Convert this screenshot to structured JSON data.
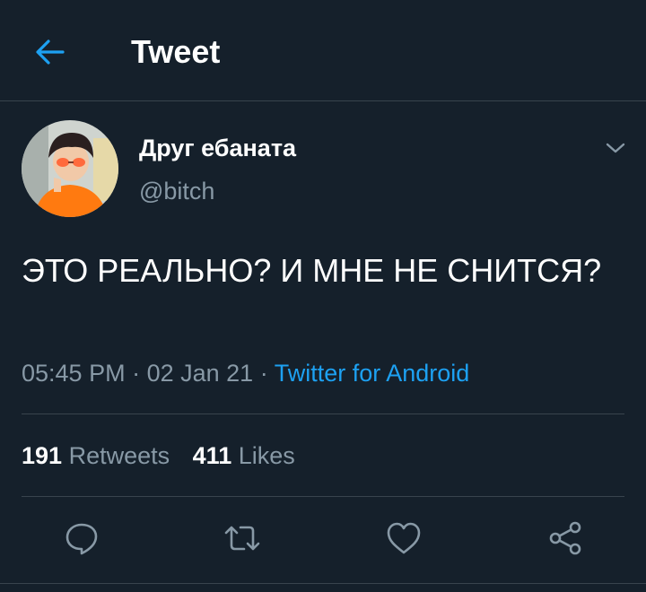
{
  "header": {
    "title": "Tweet",
    "back_icon": "arrow-left-icon"
  },
  "tweet": {
    "author": {
      "display_name": "Друг ебаната",
      "handle": "@bitch",
      "avatar": "avatar-photo"
    },
    "text": "ЭТО РЕАЛЬНО? И МНЕ НЕ СНИТСЯ?",
    "time": "05:45 PM",
    "date": "02 Jan 21",
    "separator": " · ",
    "source": "Twitter for Android",
    "menu_icon": "chevron-down-icon"
  },
  "stats": {
    "retweets_count": "191",
    "retweets_label": "Retweets",
    "likes_count": "411",
    "likes_label": "Likes"
  },
  "actions": [
    "reply-icon",
    "retweet-icon",
    "like-icon",
    "share-icon"
  ],
  "colors": {
    "background": "#15202b",
    "accent": "#1da1f2",
    "secondary_text": "#8899a6",
    "divider": "#38444d"
  }
}
